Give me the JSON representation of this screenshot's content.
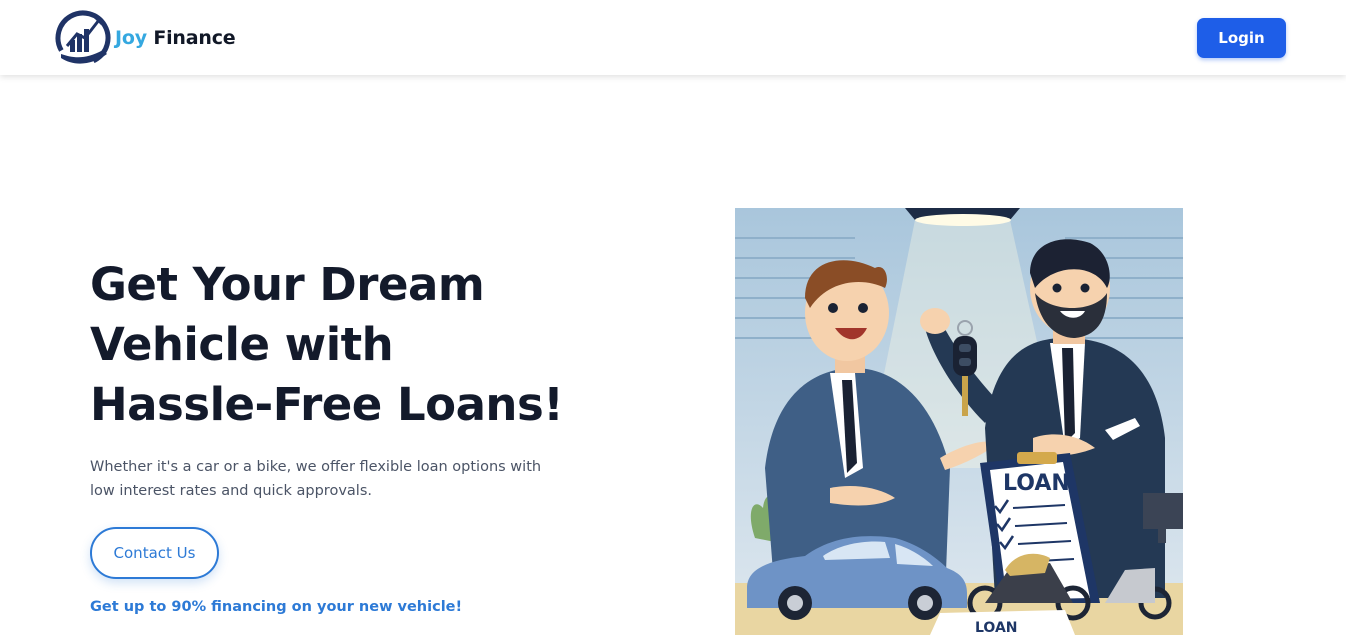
{
  "header": {
    "brand": {
      "name_part1": "Joy",
      "name_part2": "Finance",
      "logo_icon": "finance-growth-logo"
    },
    "login_label": "Login"
  },
  "hero": {
    "title": "Get Your Dream Vehicle with Hassle-Free Loans!",
    "subtitle": "Whether it's a car or a bike, we offer flexible loan options with low interest rates and quick approvals.",
    "contact_label": "Contact Us",
    "promo": "Get up to 90% financing on your new vehicle!"
  },
  "illustration": {
    "clipboard_text": "LOAN",
    "paper_text": "LOAN"
  },
  "colors": {
    "brand_blue": "#1e5ee8",
    "accent_blue": "#2d7ad6",
    "brand_light": "#35a8e0",
    "heading": "#131a2b"
  }
}
